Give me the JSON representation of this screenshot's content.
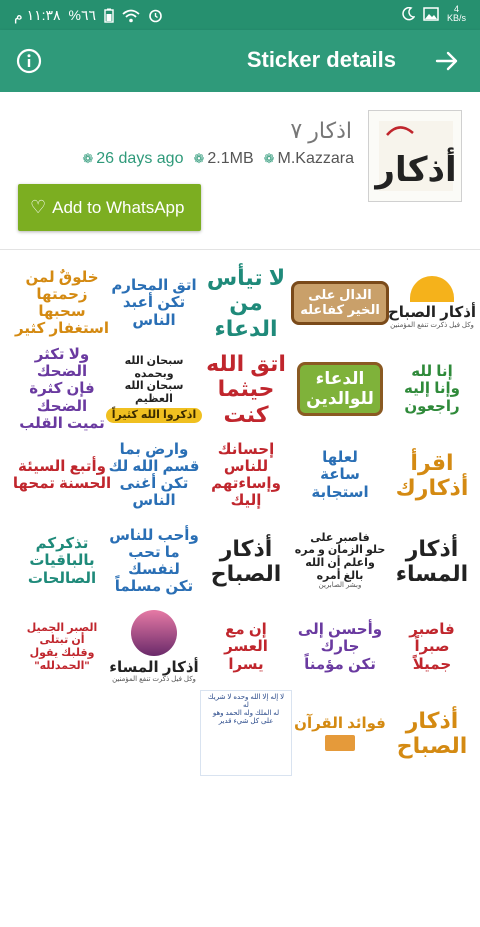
{
  "status_bar": {
    "time": "١١:٣٨ م",
    "battery": "%٦٦",
    "net_speed_value": "4",
    "net_speed_unit": "KB/s"
  },
  "app_bar": {
    "title": "Sticker details",
    "info_icon": "info-icon",
    "back_icon": "arrow-right-icon"
  },
  "pack": {
    "title": "اذكار ٧",
    "age": "26 days ago",
    "size": "2.1MB",
    "author": "M.Kazzara",
    "icon_text": "أذكار"
  },
  "add_button": {
    "label": "Add to WhatsApp",
    "icon": "heart-outline-icon"
  },
  "stickers": [
    {
      "lines": [
        "أذكار الصباح"
      ],
      "sub": "وكل فيل ذكرت تنفع المؤمنين",
      "style": "dark",
      "deco": "sun"
    },
    {
      "lines": [
        "الدال على",
        "الخير كفاعله"
      ],
      "style": "plate"
    },
    {
      "lines": [
        "لا تيأس",
        "من الدعاء"
      ],
      "style": "teal"
    },
    {
      "lines": [
        "اتق المحارم",
        "تكن أعبد الناس"
      ],
      "style": "blue"
    },
    {
      "lines": [
        "خلوقٌ لمن",
        "زحمتها سحبها",
        "استغفار كثير"
      ],
      "style": "gold"
    },
    {
      "lines": [
        "إنا لله",
        "وإنا إليه",
        "راجعون"
      ],
      "style": "green"
    },
    {
      "lines": [
        "الدعاء",
        "للوالدين"
      ],
      "style": "plate-green"
    },
    {
      "lines": [
        "اتق الله",
        "حيثما كنت"
      ],
      "style": "red"
    },
    {
      "lines": [
        "سبحان الله",
        "وبحمده",
        "سبحان الله",
        "العظيم"
      ],
      "pill": "اذكروا الله كثيراً",
      "style": "dark"
    },
    {
      "lines": [
        "ولا تكثر الضحك",
        "فإن كثرة الضحك",
        "تميت القلب"
      ],
      "style": "purple"
    },
    {
      "lines": [
        "اقرأ",
        "أذكارك"
      ],
      "style": "gold"
    },
    {
      "lines": [
        "لعلها",
        "ساعة",
        "استجابة"
      ],
      "style": "blue"
    },
    {
      "lines": [
        "إحسانك للناس",
        "وإساءتهم إليك"
      ],
      "style": "red"
    },
    {
      "lines": [
        "وارض بما",
        "قسم الله لك",
        "تكن أغنى الناس"
      ],
      "style": "blue"
    },
    {
      "lines": [
        "وأتبع السيئة",
        "الحسنة تمحها"
      ],
      "style": "red"
    },
    {
      "lines": [
        "أذكار",
        "المساء"
      ],
      "style": "dark"
    },
    {
      "lines": [
        "فاصبر على",
        "حلو الزمان و مره",
        "واعلم أن الله",
        "بالغ أمره"
      ],
      "sub": "وبشر الصابرين",
      "style": "dark"
    },
    {
      "lines": [
        "أذكار",
        "الصباح"
      ],
      "style": "dark"
    },
    {
      "lines": [
        "وأحب للناس",
        "ما تحب لنفسك",
        "تكن مسلماً"
      ],
      "style": "blue"
    },
    {
      "lines": [
        "تذكركم",
        "بالباقيات",
        "الصالحات"
      ],
      "style": "teal"
    },
    {
      "lines": [
        "فاصبر",
        "صبراً",
        "جميلاً"
      ],
      "style": "red"
    },
    {
      "lines": [
        "وأحسن إلى جارك",
        "تكن مؤمناً"
      ],
      "style": "purple"
    },
    {
      "lines": [
        "إن مع",
        "العسر",
        "يسرا"
      ],
      "style": "red"
    },
    {
      "lines": [
        "أذكار المساء"
      ],
      "sub": "وكل فيل ذكرت تنفع المؤمنين",
      "style": "dark",
      "deco": "circle"
    },
    {
      "lines": [
        "الصبر الجميل",
        "أن تبتلى",
        "وقلبك يقول",
        "\"الحمدلله\""
      ],
      "style": "red"
    },
    {
      "lines": [
        "أذكار",
        "الصباح"
      ],
      "style": "gold"
    },
    {
      "lines": [
        "فوائد القرآن"
      ],
      "style": "gold",
      "deco": "book"
    },
    {
      "lines": [
        "لا إله إلا الله وحده لا شريك له",
        "له الملك وله الحمد وهو",
        "على كل شيء قدير"
      ],
      "style": "doc"
    }
  ]
}
